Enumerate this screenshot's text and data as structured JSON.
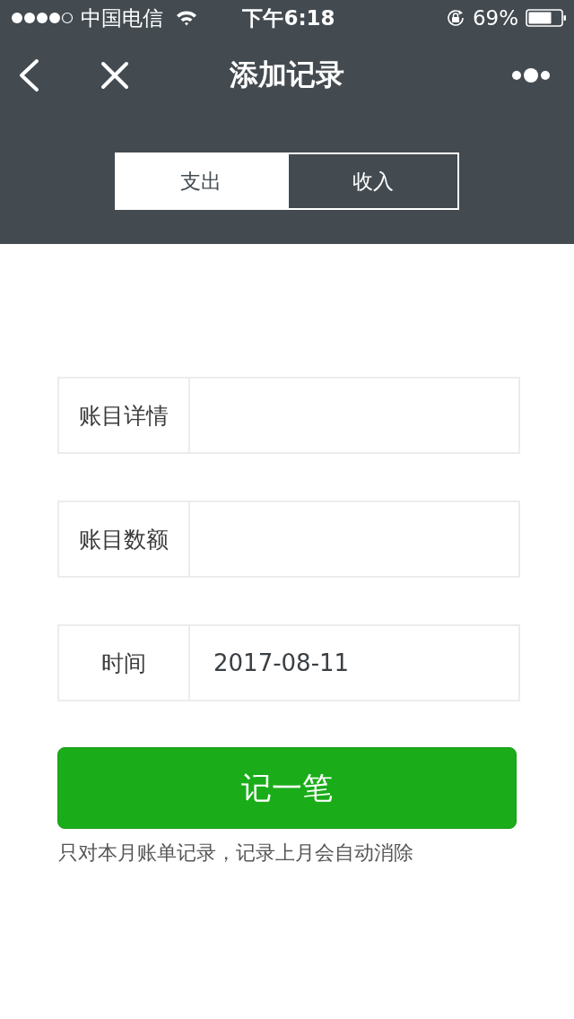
{
  "status_bar": {
    "carrier": "中国电信",
    "time": "下午6:18",
    "battery": "69%"
  },
  "nav_bar": {
    "title": "添加记录"
  },
  "tabs": [
    {
      "label": "支出",
      "selected": true
    },
    {
      "label": "收入",
      "selected": false
    }
  ],
  "form": {
    "fields": [
      {
        "label": "账目详情"
      },
      {
        "label": "账目数额"
      },
      {
        "label": "时间",
        "value": "2017-08-11"
      }
    ]
  },
  "submit_button": "记一笔",
  "note": "只对本月账单记录，记录上月会自动消除"
}
